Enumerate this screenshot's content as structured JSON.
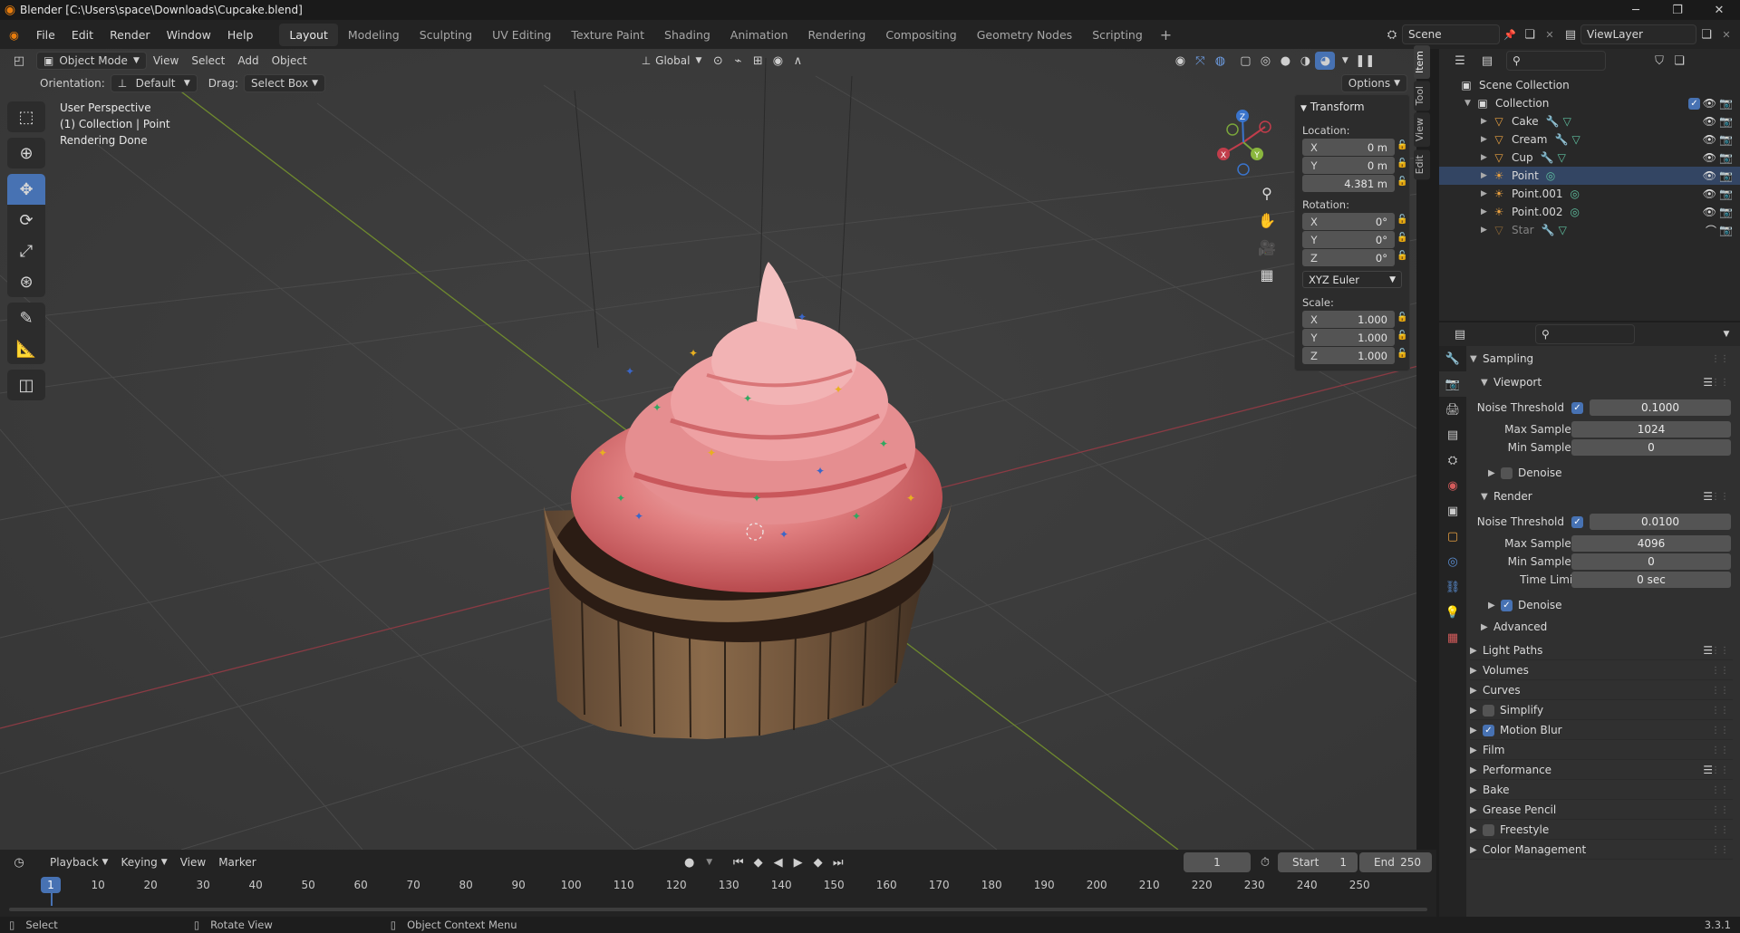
{
  "app": {
    "title": "Blender [C:\\Users\\space\\Downloads\\Cupcake.blend]",
    "version": "3.3.1"
  },
  "topbar": {
    "menus": [
      "File",
      "Edit",
      "Render",
      "Window",
      "Help"
    ],
    "workspaces": [
      "Layout",
      "Modeling",
      "Sculpting",
      "UV Editing",
      "Texture Paint",
      "Shading",
      "Animation",
      "Rendering",
      "Compositing",
      "Geometry Nodes",
      "Scripting"
    ],
    "active_workspace": "Layout",
    "scene": "Scene",
    "view_layer": "ViewLayer"
  },
  "viewport": {
    "mode": "Object Mode",
    "menus": [
      "View",
      "Select",
      "Add",
      "Object"
    ],
    "transform_orientation": "Global",
    "orientation_label": "Orientation:",
    "orientation_value": "Default",
    "drag_label": "Drag:",
    "drag_value": "Select Box",
    "options_label": "Options",
    "info": [
      "User Perspective",
      "(1) Collection | Point",
      "Rendering Done"
    ]
  },
  "gizmo": {
    "x": "X",
    "y": "Y",
    "z": "Z"
  },
  "npanel": {
    "title": "Transform",
    "location_label": "Location:",
    "location": [
      {
        "axis": "X",
        "value": "0 m"
      },
      {
        "axis": "Y",
        "value": "0 m"
      },
      {
        "axis": "Z",
        "value": "4.381 m"
      }
    ],
    "rotation_label": "Rotation:",
    "rotation": [
      {
        "axis": "X",
        "value": "0°"
      },
      {
        "axis": "Y",
        "value": "0°"
      },
      {
        "axis": "Z",
        "value": "0°"
      }
    ],
    "rotation_mode": "XYZ Euler",
    "scale_label": "Scale:",
    "scale": [
      {
        "axis": "X",
        "value": "1.000"
      },
      {
        "axis": "Y",
        "value": "1.000"
      },
      {
        "axis": "Z",
        "value": "1.000"
      }
    ],
    "tabs": [
      "Item",
      "Tool",
      "View",
      "Edit"
    ]
  },
  "timeline": {
    "menus": [
      "Playback",
      "Keying",
      "View",
      "Marker"
    ],
    "current_frame": "1",
    "start_label": "Start",
    "start": "1",
    "end_label": "End",
    "end": "250",
    "ticks": [
      "1",
      "10",
      "20",
      "30",
      "40",
      "50",
      "60",
      "70",
      "80",
      "90",
      "100",
      "110",
      "120",
      "130",
      "140",
      "150",
      "160",
      "170",
      "180",
      "190",
      "200",
      "210",
      "220",
      "230",
      "240",
      "250"
    ]
  },
  "statusbar": {
    "items": [
      "Select",
      "Rotate View",
      "Object Context Menu"
    ]
  },
  "outliner": {
    "root": "Scene Collection",
    "collection": "Collection",
    "items": [
      {
        "name": "Cake",
        "type": "mesh"
      },
      {
        "name": "Cream",
        "type": "mesh"
      },
      {
        "name": "Cup",
        "type": "mesh"
      },
      {
        "name": "Point",
        "type": "light"
      },
      {
        "name": "Point.001",
        "type": "light"
      },
      {
        "name": "Point.002",
        "type": "light"
      },
      {
        "name": "Star",
        "type": "mesh"
      }
    ]
  },
  "properties": {
    "sampling": "Sampling",
    "viewport": "Viewport",
    "vp_noise_threshold_label": "Noise Threshold",
    "vp_noise_threshold": "0.1000",
    "vp_max_samples_label": "Max Samples",
    "vp_max_samples": "1024",
    "vp_min_samples_label": "Min Samples",
    "vp_min_samples": "0",
    "vp_denoise": "Denoise",
    "render": "Render",
    "r_noise_threshold_label": "Noise Threshold",
    "r_noise_threshold": "0.0100",
    "r_max_samples_label": "Max Samples",
    "r_max_samples": "4096",
    "r_min_samples_label": "Min Samples",
    "r_min_samples": "0",
    "r_time_limit_label": "Time Limit",
    "r_time_limit": "0 sec",
    "r_denoise": "Denoise",
    "advanced": "Advanced",
    "sections": [
      "Light Paths",
      "Volumes",
      "Curves",
      "Simplify",
      "Motion Blur",
      "Film",
      "Performance",
      "Bake",
      "Grease Pencil",
      "Freestyle",
      "Color Management"
    ]
  },
  "colors": {
    "accent": "#4772b3",
    "x_axis": "#c13d4b",
    "y_axis": "#7aa53b",
    "z_axis": "#3a74cc",
    "blender_orange": "#e87d0d"
  }
}
